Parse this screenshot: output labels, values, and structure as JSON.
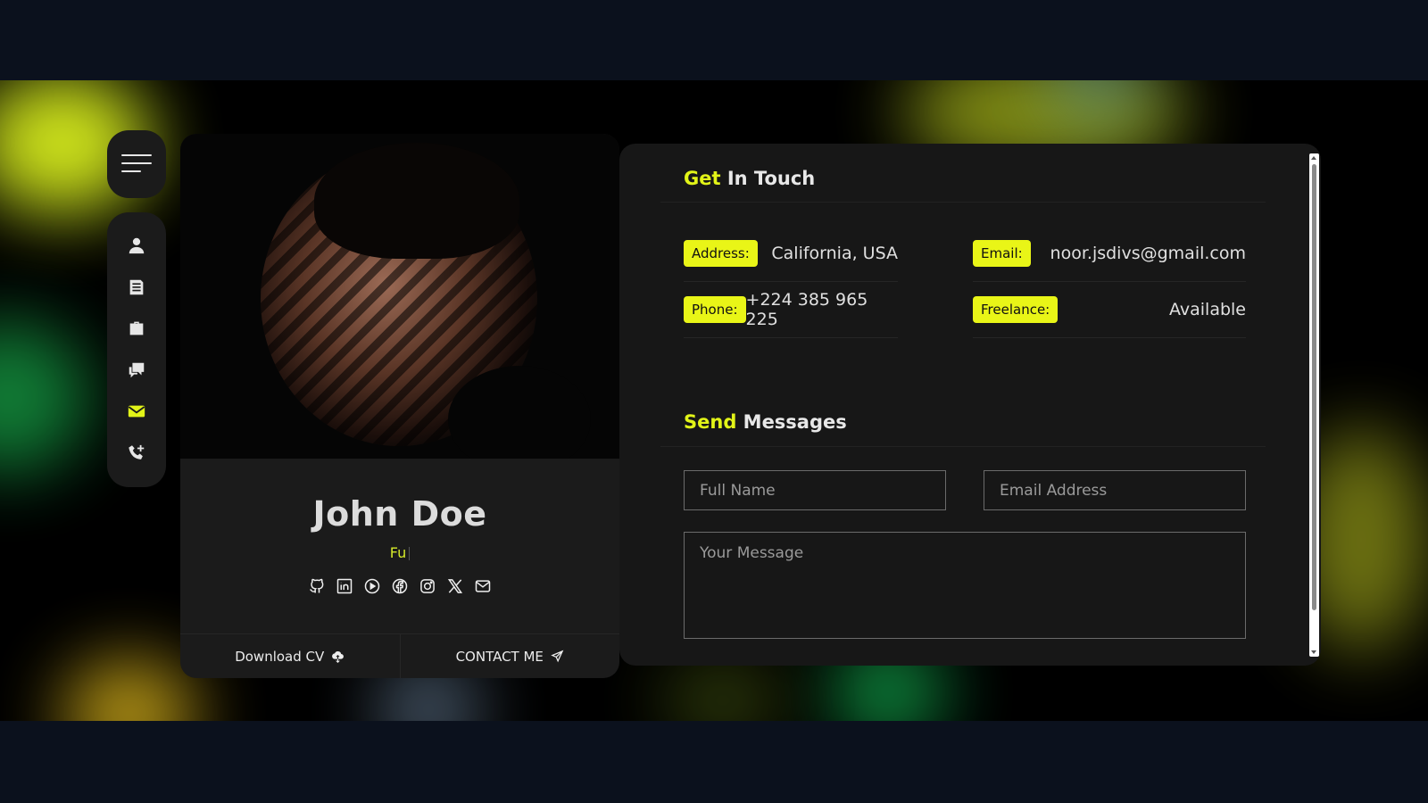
{
  "profile": {
    "name": "John Doe",
    "role_typing": "Fu",
    "download_cv": "Download CV",
    "contact_me": "CONTACT ME"
  },
  "nav": {
    "items": [
      "user-icon",
      "resume-icon",
      "briefcase-icon",
      "chat-icon",
      "mail-icon",
      "phone-icon"
    ],
    "active": "mail-icon",
    "accent": "#e2f418"
  },
  "socials": [
    "github-icon",
    "linkedin-icon",
    "play-icon",
    "facebook-icon",
    "instagram-icon",
    "x-icon",
    "mail-icon"
  ],
  "get_in_touch": {
    "title_highlight": "Get",
    "title_rest": " In Touch",
    "address_label": "Address:",
    "address_value": "California, USA",
    "email_label": "Email:",
    "email_value": "noor.jsdivs@gmail.com",
    "phone_label": "Phone:",
    "phone_value": "+224 385 965 225",
    "freelance_label": "Freelance:",
    "freelance_value": "Available"
  },
  "send_messages": {
    "title_highlight": "Send",
    "title_rest": " Messages",
    "full_name_placeholder": "Full Name",
    "email_placeholder": "Email Address",
    "message_placeholder": "Your Message"
  },
  "colors": {
    "accent": "#e2f418",
    "panel": "#171717",
    "card": "#1b1b1b"
  }
}
